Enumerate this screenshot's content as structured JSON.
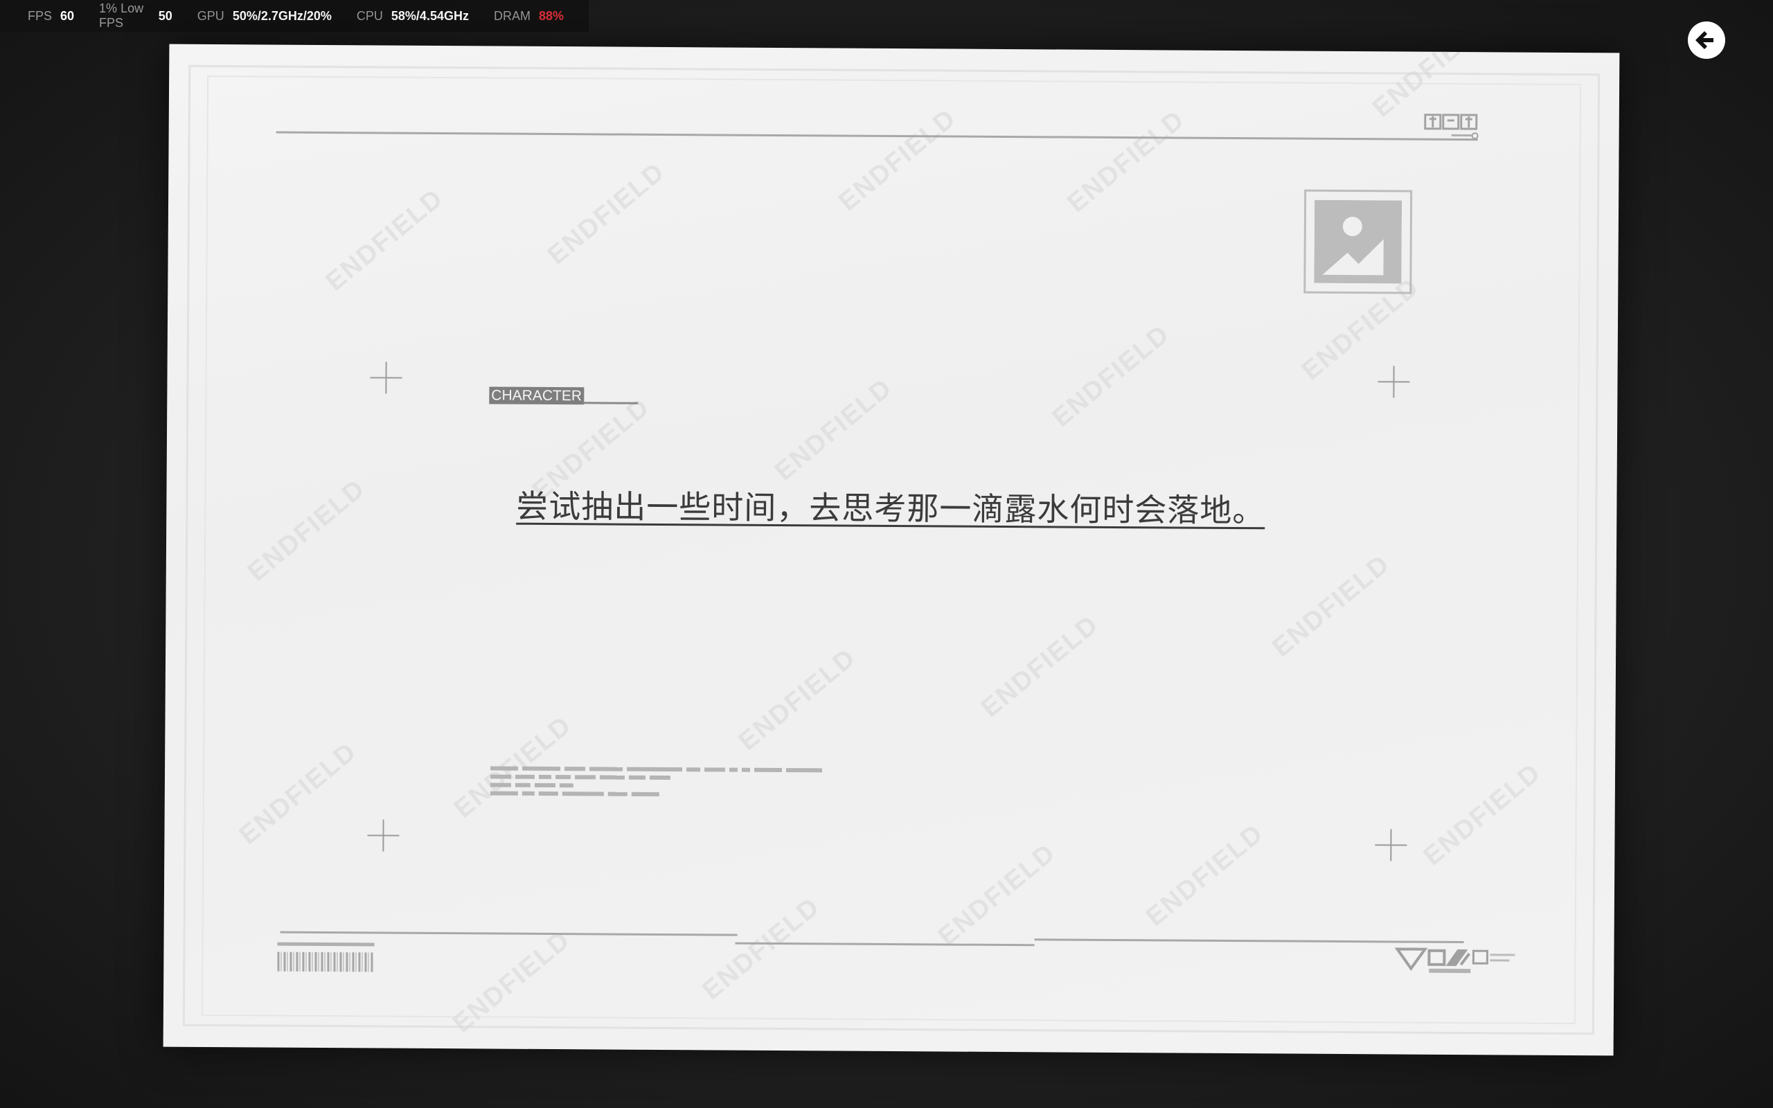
{
  "perf": {
    "items": [
      {
        "label": "FPS",
        "value": "60",
        "alert": false
      },
      {
        "label": "1% Low FPS",
        "value": "50",
        "alert": false
      },
      {
        "label": "GPU",
        "value": "50%/2.7GHz/20%",
        "alert": false
      },
      {
        "label": "CPU",
        "value": "58%/4.54GHz",
        "alert": false
      },
      {
        "label": "DRAM",
        "value": "88%",
        "alert": true
      }
    ]
  },
  "back_button": {
    "icon": "arrow-left-icon"
  },
  "card": {
    "watermark": "ENDFIELD",
    "character_label": "CHARACTER",
    "quote": "尝试抽出一些时间，去思考那一滴露水何时会落地。",
    "image_placeholder_icon": "image-placeholder-icon"
  },
  "colors": {
    "alert": "#e0303a",
    "card_bg": "#f1f1f1",
    "text": "#3b3b3b"
  }
}
